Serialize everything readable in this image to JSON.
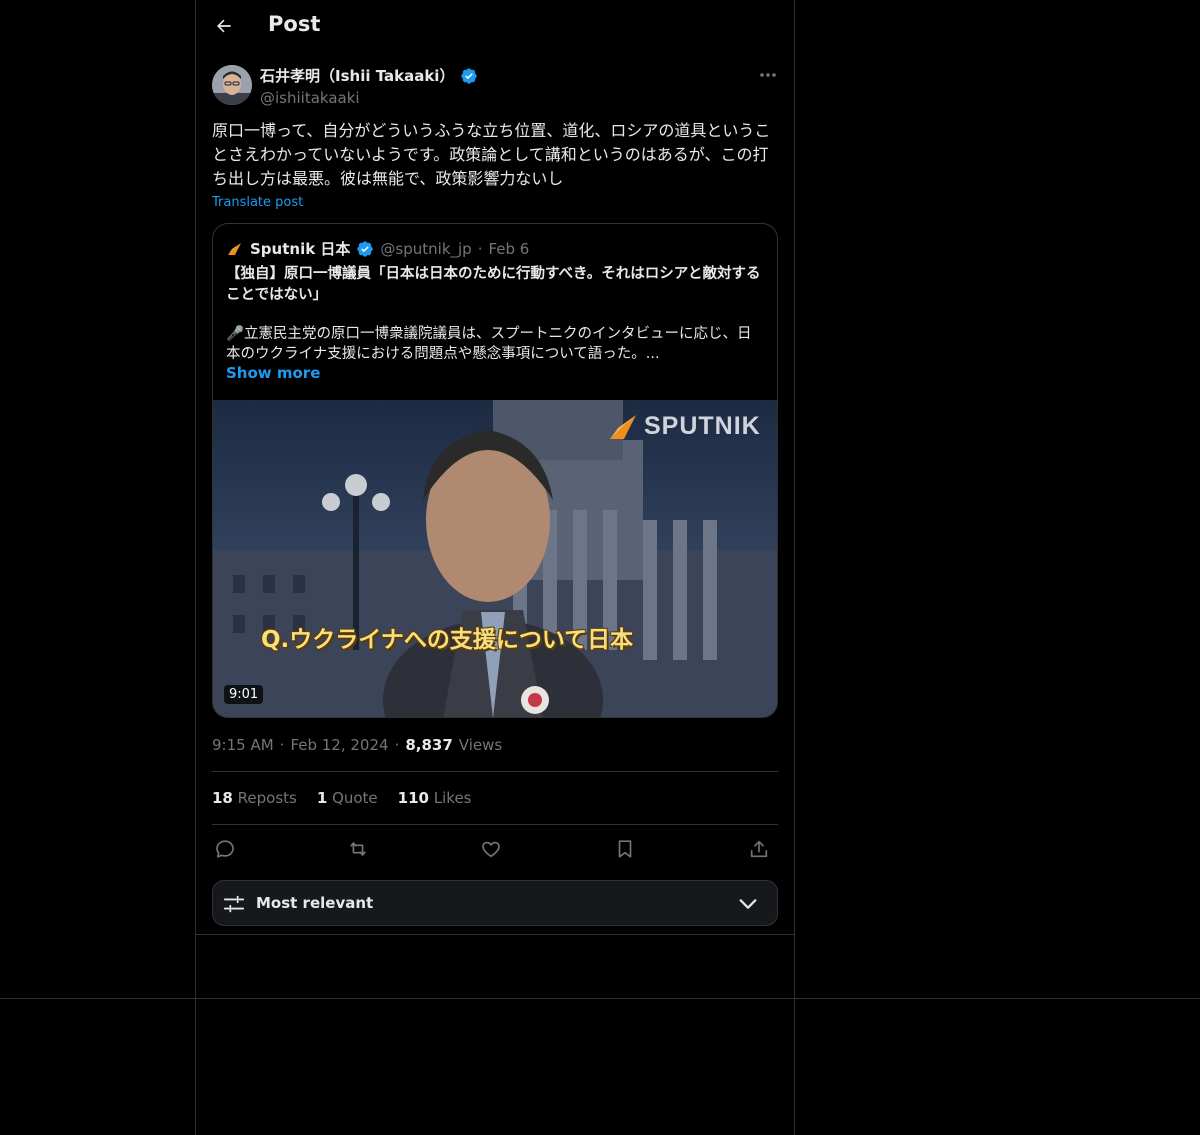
{
  "header": {
    "title": "Post"
  },
  "post": {
    "author_name": "石井孝明（Ishii Takaaki）",
    "author_handle": "@ishiitakaaki",
    "text": "原口一博って、自分がどういうふうな立ち位置、道化、ロシアの道具ということさえわかっていないようです。政策論として講和というのはあるが、この打ち出し方は最悪。彼は無能で、政策影響力ないし",
    "translate_label": "Translate post",
    "time": "9:15 AM",
    "date": "Feb 12, 2024",
    "views_count": "8,837",
    "views_label": "Views",
    "reposts_count": "18",
    "reposts_label": "Reposts",
    "quotes_count": "1",
    "quotes_label": "Quote",
    "likes_count": "110",
    "likes_label": "Likes"
  },
  "quoted": {
    "author_name": "Sputnik 日本",
    "author_handle": "@sputnik_jp",
    "date": "Feb 6",
    "title": "【独自】原口一博議員「日本は日本のために行動すべき。それはロシアと敵対することではない」",
    "body": "🎤立憲民主党の原口一博衆議院議員は、スプートニクのインタビューに応じ、日本のウクライナ支援における問題点や懸念事項について語った。...",
    "show_more": "Show more",
    "video": {
      "watermark": "SPUTNIK",
      "caption": "Q.ウクライナへの支援について日本",
      "duration": "9:01"
    }
  },
  "sort": {
    "label": "Most relevant"
  },
  "colors": {
    "accent": "#1d9bf0",
    "background": "#000000",
    "border": "#2f3336",
    "muted": "#71767b",
    "sputnik_orange": "#f28c1a"
  }
}
